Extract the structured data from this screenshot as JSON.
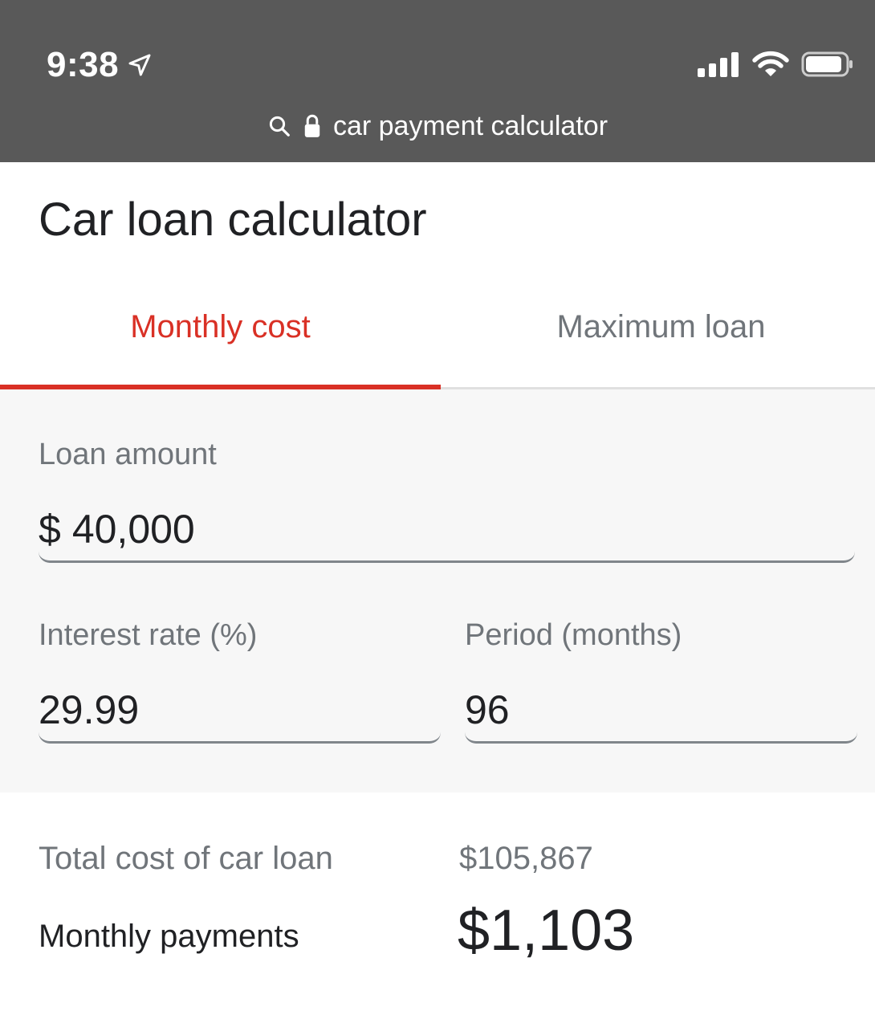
{
  "status_bar": {
    "time": "9:38"
  },
  "url_bar": {
    "query": "car payment calculator"
  },
  "calculator": {
    "title": "Car loan calculator",
    "tabs": [
      {
        "label": "Monthly cost",
        "active": true
      },
      {
        "label": "Maximum loan",
        "active": false
      }
    ],
    "loan_amount": {
      "label": "Loan amount",
      "prefix": "$",
      "value": "40,000"
    },
    "interest_rate": {
      "label": "Interest rate (%)",
      "value": "29.99"
    },
    "period": {
      "label": "Period (months)",
      "value": "96"
    },
    "results": {
      "total_label": "Total cost of car loan",
      "total_value": "$105,867",
      "monthly_label": "Monthly payments",
      "monthly_value": "$1,103"
    }
  },
  "colors": {
    "status_bar_bg": "#595959",
    "accent": "#d93025",
    "muted_text": "#70757a",
    "form_bg": "#f7f7f7"
  }
}
